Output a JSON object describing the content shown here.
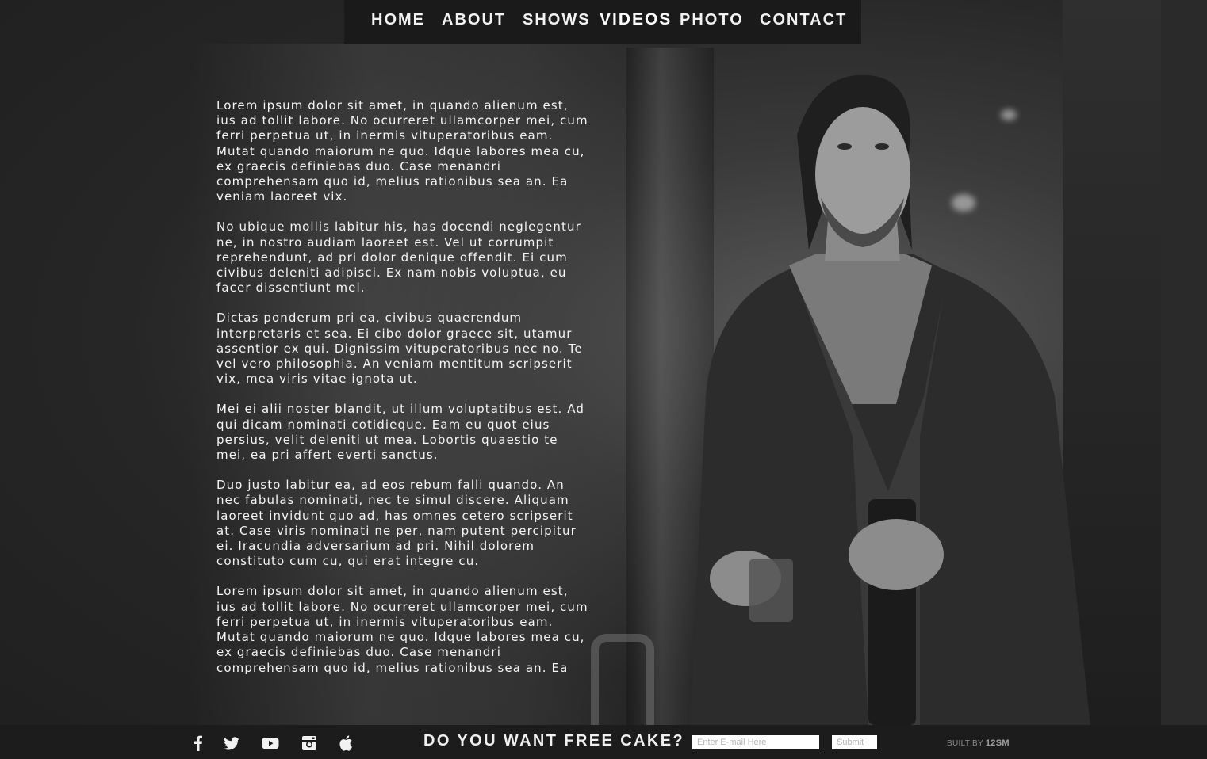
{
  "nav": {
    "items": [
      {
        "label": "HOME"
      },
      {
        "label": "ABOUT"
      },
      {
        "label": "SHOWS"
      },
      {
        "label": "VIDEOS"
      },
      {
        "label": "PHOTO"
      },
      {
        "label": "CONTACT"
      }
    ],
    "active": "VIDEOS"
  },
  "content": {
    "paragraphs": [
      "Lorem ipsum dolor sit amet, in quando alienum est, ius ad tollit labore. No ocurreret ullamcorper mei, cum ferri perpetua ut, in inermis vituperatoribus eam. Mutat quando maiorum ne quo. Idque labores mea cu, ex graecis definiebas duo. Case menandri comprehensam quo id, melius rationibus sea an. Ea veniam laoreet vix.",
      "No ubique mollis labitur his, has docendi neglegentur ne, in nostro audiam laoreet est. Vel ut corrumpit reprehendunt, ad pri dolor denique offendit. Ei cum civibus deleniti adipisci. Ex nam nobis voluptua, eu facer dissentiunt mel.",
      "Dictas ponderum pri ea, civibus quaerendum interpretaris et sea. Ei cibo dolor graece sit, utamur assentior ex qui. Dignissim vituperatoribus nec no. Te vel vero philosophia. An veniam mentitum scripserit vix, mea viris vitae ignota ut.",
      "Mei ei alii noster blandit, ut illum voluptatibus est. Ad qui dicam nominati cotidieque. Eam eu quot eius persius, velit deleniti ut mea. Lobortis quaestio te mei, ea pri affert everti sanctus.",
      "Duo justo labitur ea, ad eos rebum falli quando. An nec fabulas nominati, nec te simul discere. Aliquam laoreet invidunt quo ad, has omnes cetero scripserit at. Case viris nominati ne per, nam putent percipitur ei. Iracundia adversarium ad pri. Nihil dolorem constituto cum cu, qui erat integre cu.",
      "Lorem ipsum dolor sit amet, in quando alienum est, ius ad tollit labore. No ocurreret ullamcorper mei, cum ferri perpetua ut, in inermis vituperatoribus eam. Mutat quando maiorum ne quo. Idque labores mea cu, ex graecis definiebas duo. Case menandri comprehensam quo id, melius rationibus sea an. Ea"
    ]
  },
  "footer": {
    "social_icons": [
      "facebook-icon",
      "twitter-icon",
      "youtube-icon",
      "instagram-icon",
      "apple-icon"
    ],
    "cta": "DO YOU WANT FREE CAKE?",
    "email_placeholder": "Enter E-mail Here",
    "submit_label": "Submit",
    "built_by_prefix": "BUILT BY",
    "built_by_name": "12SM"
  },
  "colors": {
    "nav_bg": "#1a1a1a",
    "footer_bg": "#1c1c1c",
    "text": "#f4f4f4"
  }
}
